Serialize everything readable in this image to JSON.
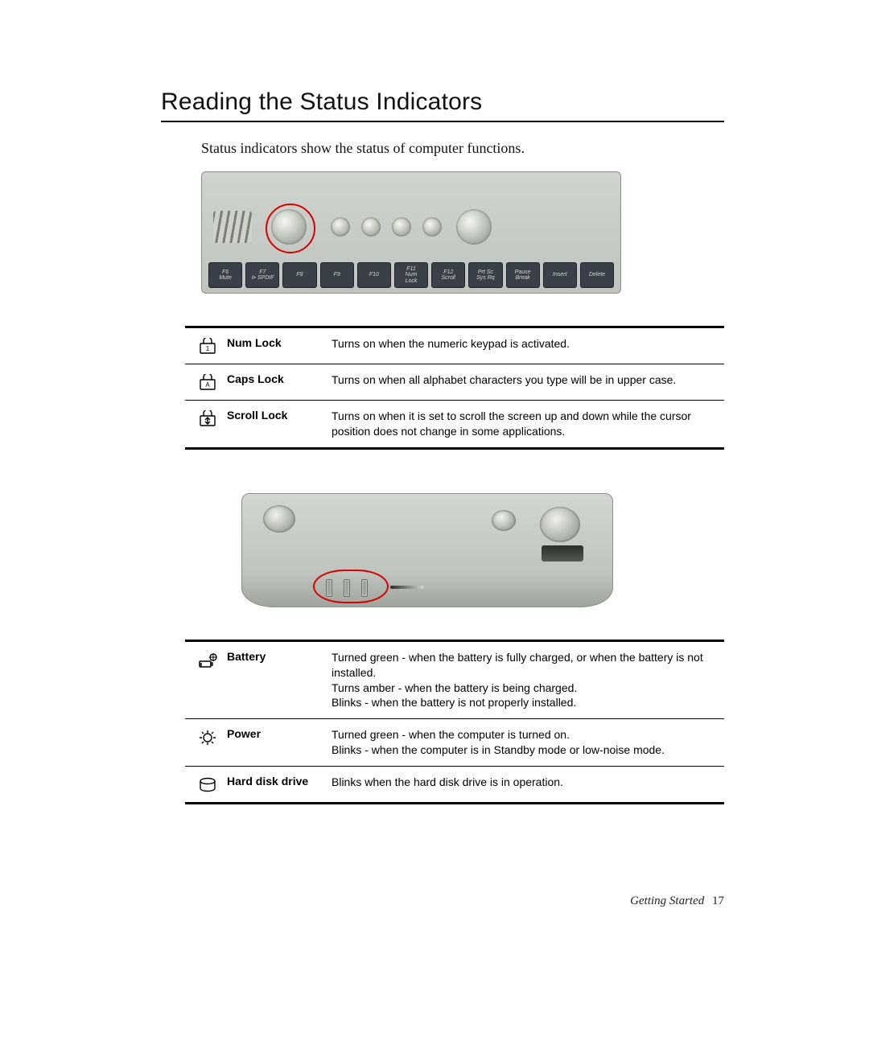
{
  "title": "Reading the Status Indicators",
  "intro": "Status indicators show the status of computer functions.",
  "keys": [
    "F6\nMute",
    "F7\n⊳ SPDIF",
    "F8",
    "F9",
    "F10",
    "F11\nNum\nLock",
    "F12\nScroll",
    "Prt Sc\nSys Rq",
    "Pause\nBreak",
    "Insert",
    "Delete"
  ],
  "table1": [
    {
      "icon": "numlock-icon",
      "label": "Num Lock",
      "desc": "Turns on when the numeric keypad is activated."
    },
    {
      "icon": "capslock-icon",
      "label": "Caps Lock",
      "desc": "Turns on when all alphabet characters you type will be in upper case."
    },
    {
      "icon": "scrolllock-icon",
      "label": "Scroll Lock",
      "desc": "Turns on when it is set to scroll the screen up and down while the cursor position does not change in some applications."
    }
  ],
  "table2": [
    {
      "icon": "battery-icon",
      "label": "Battery",
      "desc": "Turned green - when the battery is fully charged, or when the battery is not installed.\nTurns amber - when the battery is being charged.\nBlinks - when the battery is not properly installed."
    },
    {
      "icon": "power-icon",
      "label": "Power",
      "desc": "Turned green - when the computer is turned on.\nBlinks - when the computer is in Standby mode or low-noise mode."
    },
    {
      "icon": "hdd-icon",
      "label": "Hard disk drive",
      "desc": "Blinks when the hard disk drive is in operation."
    }
  ],
  "footer": {
    "section": "Getting Started",
    "page": "17"
  }
}
